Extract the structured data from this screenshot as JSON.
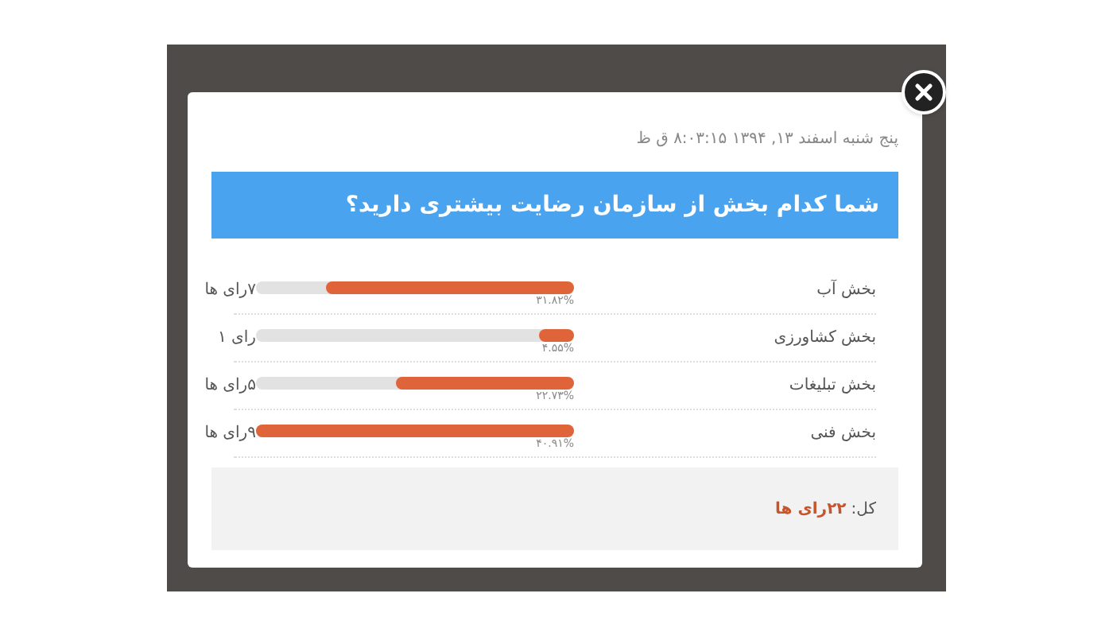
{
  "poll": {
    "date": "پنج شنبه اسفند ۱۳, ۱۳۹۴ ۸:۰۳:۱۵ ق ظ",
    "question": "شما کدام بخش از سازمان رضایت بیشتری دارید؟",
    "options": [
      {
        "label": "بخش آب",
        "level": 0.78,
        "percent": "۳۱.۸۲%",
        "votes": "۷رای ها"
      },
      {
        "label": "بخش کشاورزی",
        "level": 0.11,
        "percent": "۴.۵۵%",
        "votes": "رای ۱"
      },
      {
        "label": "بخش تبلیغات",
        "level": 0.56,
        "percent": "۲۲.۷۳%",
        "votes": "۵رای ها"
      },
      {
        "label": "بخش فنی",
        "level": 1.0,
        "percent": "۴۰.۹۱%",
        "votes": "۹رای ها"
      }
    ],
    "total_label": "کل:",
    "total_value": "۲۲رای ها"
  }
}
